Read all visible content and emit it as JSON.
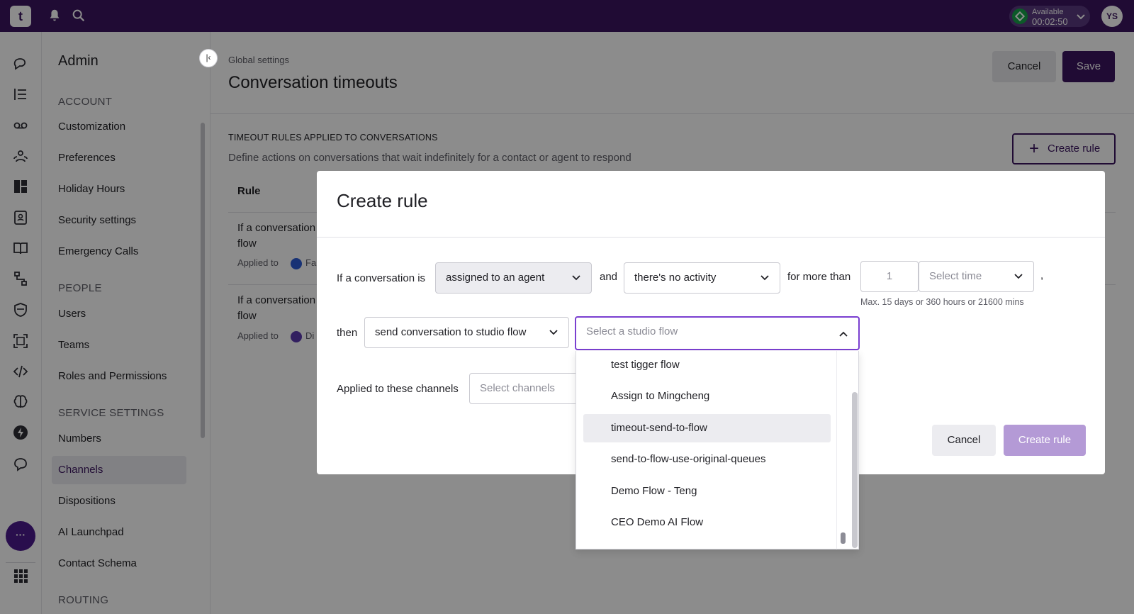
{
  "topbar": {
    "logo": "t",
    "status_label": "Available",
    "status_timer": "00:02:50",
    "avatar_initials": "YS"
  },
  "admin": {
    "title": "Admin",
    "sections": [
      {
        "label": "ACCOUNT",
        "items": [
          "Customization",
          "Preferences",
          "Holiday Hours",
          "Security settings",
          "Emergency Calls"
        ]
      },
      {
        "label": "PEOPLE",
        "items": [
          "Users",
          "Teams",
          "Roles and Permissions"
        ]
      },
      {
        "label": "SERVICE SETTINGS",
        "items": [
          "Numbers",
          "Channels",
          "Dispositions",
          "AI Launchpad",
          "Contact Schema"
        ]
      },
      {
        "label": "ROUTING",
        "items": []
      }
    ],
    "active_item": "Channels"
  },
  "page": {
    "breadcrumb": "Global settings",
    "title": "Conversation timeouts",
    "cancel_label": "Cancel",
    "save_label": "Save",
    "section_title": "TIMEOUT RULES APPLIED TO CONVERSATIONS",
    "section_desc": "Define actions on conversations that wait indefinitely for a contact or agent to respond",
    "create_rule_label": "Create rule",
    "table_header": "Rule",
    "rules": [
      {
        "text": "If a conversation",
        "text2": "flow",
        "applied": "Applied to",
        "chip": "Fa"
      },
      {
        "text": "If a conversation",
        "text2": "flow",
        "applied": "Applied to",
        "chip": "Di"
      }
    ]
  },
  "modal": {
    "title": "Create rule",
    "if_label": "If a conversation is",
    "assignment_value": "assigned to an agent",
    "and_label": "and",
    "activity_value": "there's no activity",
    "more_than_label": "for more than",
    "duration_placeholder": "1",
    "time_placeholder": "Select time",
    "comma": ",",
    "hint": "Max. 15 days or 360 hours or 21600 mins",
    "then_label": "then",
    "action_value": "send conversation to studio flow",
    "flow_placeholder": "Select a studio flow",
    "channels_label": "Applied to these channels",
    "channels_placeholder": "Select channels",
    "cancel_label": "Cancel",
    "create_label": "Create rule"
  },
  "flow_options": [
    "test tigger flow",
    "Assign to Mingcheng",
    "timeout-send-to-flow",
    "send-to-flow-use-original-queues",
    "Demo Flow - Teng",
    "CEO Demo AI Flow"
  ],
  "hovered_option": "timeout-send-to-flow",
  "colors": {
    "brand": "#3b1560",
    "focus": "#7a3fd0",
    "available": "#16a34a"
  }
}
